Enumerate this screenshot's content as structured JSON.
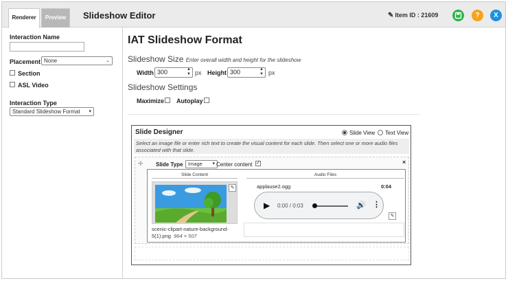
{
  "header": {
    "tabs": [
      {
        "label": "Renderer"
      },
      {
        "label": "Preview"
      }
    ],
    "title": "Slideshow Editor",
    "item_id": "Item ID : 21609",
    "save_icon": "save-icon",
    "help_icon": "?",
    "close_icon": "X",
    "colors": {
      "save": "#2db34a",
      "help": "#f7a21b",
      "close": "#1e8fe0"
    }
  },
  "sidebar": {
    "interaction_name_label": "Interaction Name",
    "interaction_name_value": "",
    "placement_label": "Placement",
    "placement_value": "None",
    "section_label": "Section",
    "asl_video_label": "ASL Video",
    "interaction_type_label": "Interaction Type",
    "interaction_type_value": "Standard Slideshow Format"
  },
  "main": {
    "title": "IAT Slideshow Format",
    "size_heading": "Slideshow Size",
    "size_hint": "Enter overall width and height for the slideshow",
    "width_label": "Width",
    "width_value": "300",
    "height_label": "Height",
    "height_value": "300",
    "unit": "px",
    "settings_heading": "Slideshow Settings",
    "maximize_label": "Maximize",
    "autoplay_label": "Autoplay"
  },
  "designer": {
    "title": "Slide Designer",
    "slide_view_label": "Slide View",
    "text_view_label": "Text View",
    "selected_view": "Slide View",
    "instructions": "Select an image file or enter rich text to create the visual content for each slide. Then select one or more audio files associated with that slide.",
    "slide": {
      "type_label": "Slide Type",
      "type_value": "Image",
      "center_content_label": "Center content",
      "center_content_checked": true,
      "content_header": "Slide Content",
      "audio_header": "Audio Files",
      "image_filename": "scenic-clipart-nature-background-5(1).png",
      "image_dims": "964 × 507",
      "audio_filename": "applause2.ogg",
      "audio_duration": "0:04",
      "player_time": "0:00 / 0:03"
    }
  }
}
